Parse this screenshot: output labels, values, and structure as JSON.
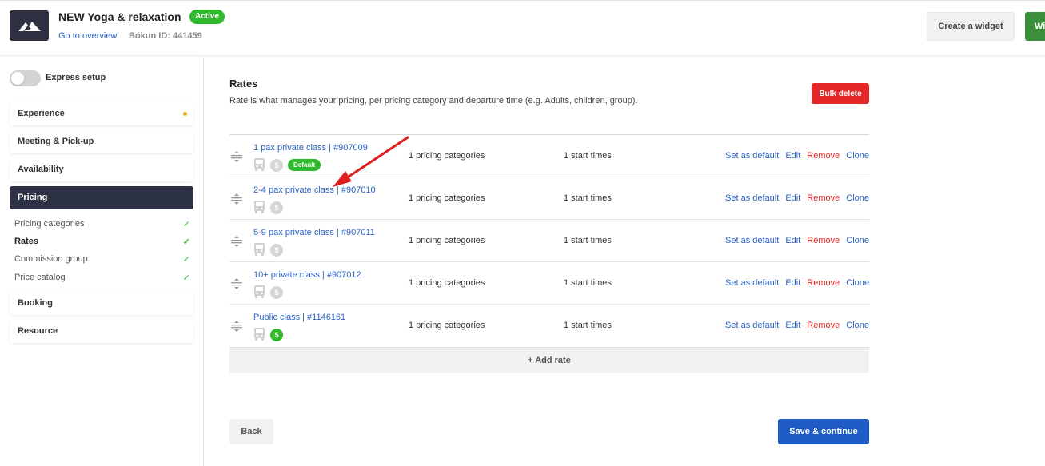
{
  "header": {
    "title": "NEW Yoga & relaxation",
    "status_badge": "Active",
    "go_overview": "Go to overview",
    "bokun_id": "Bókun ID: 441459",
    "create_widget": "Create a widget",
    "green_button": "Wi"
  },
  "sidebar": {
    "express_setup": "Express setup",
    "items": [
      {
        "label": "Experience"
      },
      {
        "label": "Meeting & Pick-up"
      },
      {
        "label": "Availability"
      },
      {
        "label": "Pricing"
      },
      {
        "label": "Booking"
      },
      {
        "label": "Resource"
      }
    ],
    "pricing_subitems": [
      {
        "label": "Pricing categories",
        "check": "✓"
      },
      {
        "label": "Rates",
        "check": "✓"
      },
      {
        "label": "Commission group",
        "check": "✓"
      },
      {
        "label": "Price catalog",
        "check": "✓"
      }
    ]
  },
  "main": {
    "title": "Rates",
    "description": "Rate is what manages your pricing, per pricing category and departure time (e.g. Adults, children, group).",
    "bulk_delete": "Bulk delete",
    "rates": [
      {
        "name": "1 pax private class | #907009",
        "pricing": "1 pricing categories",
        "start": "1 start times",
        "default_badge": "Default",
        "dollar_active": false
      },
      {
        "name": "2-4 pax private class | #907010",
        "pricing": "1 pricing categories",
        "start": "1 start times",
        "default_badge": "",
        "dollar_active": false
      },
      {
        "name": "5-9 pax private class | #907011",
        "pricing": "1 pricing categories",
        "start": "1 start times",
        "default_badge": "",
        "dollar_active": false
      },
      {
        "name": "10+ private class | #907012",
        "pricing": "1 pricing categories",
        "start": "1 start times",
        "default_badge": "",
        "dollar_active": false
      },
      {
        "name": "Public class | #1146161",
        "pricing": "1 pricing categories",
        "start": "1 start times",
        "default_badge": "",
        "dollar_active": true
      }
    ],
    "row_actions": {
      "set_default": "Set as default",
      "edit": "Edit",
      "remove": "Remove",
      "clone": "Clone"
    },
    "dollar_glyph": "$",
    "add_rate": "+ Add rate",
    "back": "Back",
    "save_continue": "Save & continue"
  },
  "colors": {
    "accent_blue": "#1f5bc4",
    "link_blue": "#2b63c4",
    "active_green": "#2fba2b",
    "danger_red": "#e32727",
    "nav_dark": "#2c3244",
    "annotation_arrow": "#e01e1e"
  }
}
